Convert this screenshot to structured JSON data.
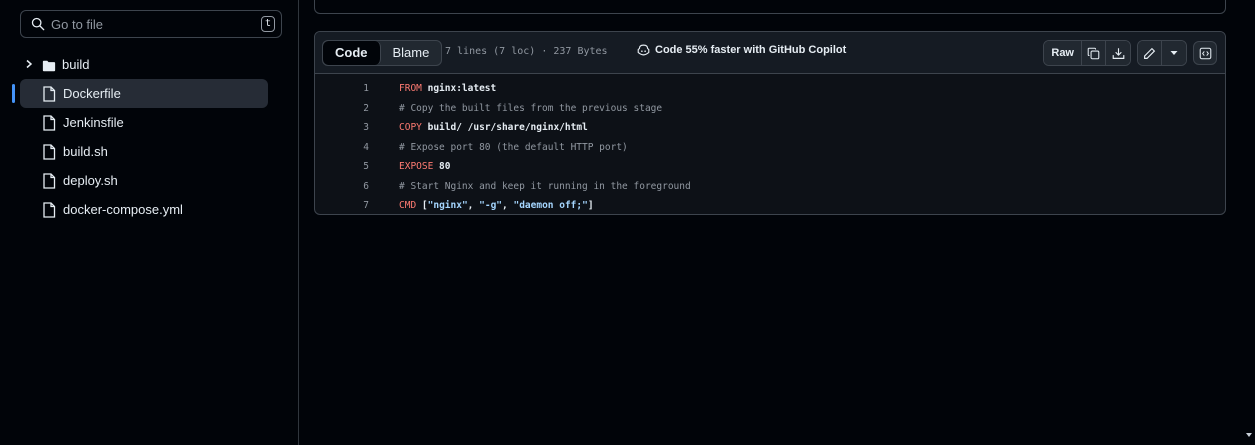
{
  "sidebar": {
    "search": {
      "placeholder": "Go to file",
      "shortcut": "t"
    },
    "items": [
      {
        "label": "build",
        "type": "folder"
      },
      {
        "label": "Dockerfile",
        "type": "file",
        "selected": true
      },
      {
        "label": "Jenkinsfile",
        "type": "file"
      },
      {
        "label": "build.sh",
        "type": "file"
      },
      {
        "label": "deploy.sh",
        "type": "file"
      },
      {
        "label": "docker-compose.yml",
        "type": "file"
      }
    ]
  },
  "file": {
    "tabs": {
      "code": "Code",
      "blame": "Blame"
    },
    "meta": "7 lines (7 loc) · 237 Bytes",
    "copilot": "Code 55% faster with GitHub Copilot",
    "raw_label": "Raw",
    "lines": [
      {
        "n": "1",
        "parts": [
          {
            "k": "kw",
            "t": "FROM "
          },
          {
            "k": "plain",
            "t": "nginx:latest"
          }
        ]
      },
      {
        "n": "2",
        "parts": [
          {
            "k": "cm",
            "t": "# Copy the built files from the previous stage"
          }
        ]
      },
      {
        "n": "3",
        "parts": [
          {
            "k": "kw",
            "t": "COPY "
          },
          {
            "k": "plain",
            "t": "build/ /usr/share/nginx/html"
          }
        ]
      },
      {
        "n": "4",
        "parts": [
          {
            "k": "cm",
            "t": "# Expose port 80 (the default HTTP port)"
          }
        ]
      },
      {
        "n": "5",
        "parts": [
          {
            "k": "kw",
            "t": "EXPOSE "
          },
          {
            "k": "plain",
            "t": "80"
          }
        ]
      },
      {
        "n": "6",
        "parts": [
          {
            "k": "cm",
            "t": "# Start Nginx and keep it running in the foreground"
          }
        ]
      },
      {
        "n": "7",
        "parts": [
          {
            "k": "kw",
            "t": "CMD "
          },
          {
            "k": "plain",
            "t": "["
          },
          {
            "k": "str",
            "t": "\"nginx\""
          },
          {
            "k": "plain",
            "t": ", "
          },
          {
            "k": "str",
            "t": "\"-g\""
          },
          {
            "k": "plain",
            "t": ", "
          },
          {
            "k": "str",
            "t": "\"daemon off;\""
          },
          {
            "k": "plain",
            "t": "]"
          }
        ]
      }
    ]
  },
  "colors": {
    "accent": "#4493f8",
    "background": "#010409",
    "keyword": "#ff7b72",
    "string": "#a5d6ff"
  }
}
